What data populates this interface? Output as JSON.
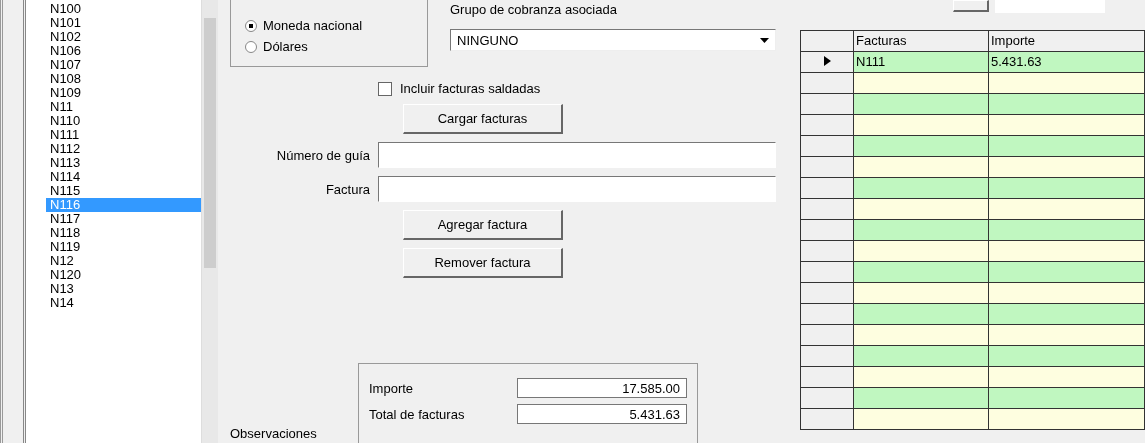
{
  "list": {
    "items": [
      {
        "label": "N100",
        "selected": false
      },
      {
        "label": "N101",
        "selected": false
      },
      {
        "label": "N102",
        "selected": false
      },
      {
        "label": "N106",
        "selected": false
      },
      {
        "label": "N107",
        "selected": false
      },
      {
        "label": "N108",
        "selected": false
      },
      {
        "label": "N109",
        "selected": false
      },
      {
        "label": "N11",
        "selected": false
      },
      {
        "label": "N110",
        "selected": false
      },
      {
        "label": "N111",
        "selected": false
      },
      {
        "label": "N112",
        "selected": false
      },
      {
        "label": "N113",
        "selected": false
      },
      {
        "label": "N114",
        "selected": false
      },
      {
        "label": "N115",
        "selected": false
      },
      {
        "label": "N116",
        "selected": true
      },
      {
        "label": "N117",
        "selected": false
      },
      {
        "label": "N118",
        "selected": false
      },
      {
        "label": "N119",
        "selected": false
      },
      {
        "label": "N12",
        "selected": false
      },
      {
        "label": "N120",
        "selected": false
      },
      {
        "label": "N13",
        "selected": false
      },
      {
        "label": "N14",
        "selected": false
      }
    ]
  },
  "currency": [
    {
      "label": "Moneda nacional",
      "selected": true
    },
    {
      "label": "Dólares",
      "selected": false
    }
  ],
  "group": {
    "label": "Grupo de cobranza asociada",
    "value": "NINGUNO"
  },
  "include_paid": {
    "label": "Incluir facturas saldadas",
    "checked": false
  },
  "load_button": "Cargar facturas",
  "fields": [
    {
      "label": "Número de guía"
    },
    {
      "label": "Factura"
    }
  ],
  "buttons": [
    "Agregar factura",
    "Remover factura"
  ],
  "totals": [
    {
      "label": "Importe",
      "value": "17.585.00"
    },
    {
      "label": "Total de facturas",
      "value": "5.431.63"
    }
  ],
  "notes_label": "Observaciones",
  "grid": {
    "columns": [
      "Facturas",
      "Importe"
    ],
    "rows": [
      {
        "cells": [
          "N111",
          "5.431.63"
        ],
        "current": true
      },
      {
        "cells": [
          "",
          ""
        ],
        "current": false
      },
      {
        "cells": [
          "",
          ""
        ],
        "current": false
      },
      {
        "cells": [
          "",
          ""
        ],
        "current": false
      },
      {
        "cells": [
          "",
          ""
        ],
        "current": false
      },
      {
        "cells": [
          "",
          ""
        ],
        "current": false
      },
      {
        "cells": [
          "",
          ""
        ],
        "current": false
      },
      {
        "cells": [
          "",
          ""
        ],
        "current": false
      },
      {
        "cells": [
          "",
          ""
        ],
        "current": false
      },
      {
        "cells": [
          "",
          ""
        ],
        "current": false
      },
      {
        "cells": [
          "",
          ""
        ],
        "current": false
      },
      {
        "cells": [
          "",
          ""
        ],
        "current": false
      },
      {
        "cells": [
          "",
          ""
        ],
        "current": false
      },
      {
        "cells": [
          "",
          ""
        ],
        "current": false
      },
      {
        "cells": [
          "",
          ""
        ],
        "current": false
      },
      {
        "cells": [
          "",
          ""
        ],
        "current": false
      },
      {
        "cells": [
          "",
          ""
        ],
        "current": false
      },
      {
        "cells": [
          "",
          ""
        ],
        "current": false
      }
    ]
  }
}
